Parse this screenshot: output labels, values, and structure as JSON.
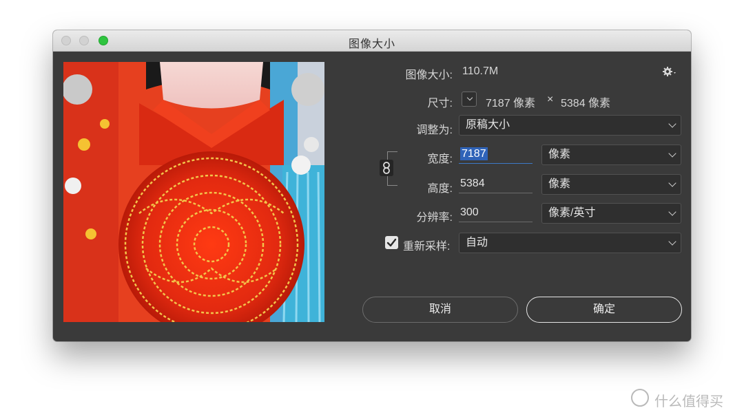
{
  "window": {
    "title": "图像大小"
  },
  "image_size": {
    "label": "图像大小:",
    "value": "110.7M"
  },
  "dimensions": {
    "label": "尺寸:",
    "width": "7187 像素",
    "separator": "×",
    "height": "5384 像素"
  },
  "fit_to": {
    "label": "调整为:",
    "value": "原稿大小"
  },
  "width": {
    "label": "宽度:",
    "value": "7187",
    "unit": "像素"
  },
  "height": {
    "label": "高度:",
    "value": "5384",
    "unit": "像素"
  },
  "resolution": {
    "label": "分辨率:",
    "value": "300",
    "unit": "像素/英寸"
  },
  "resample": {
    "label": "重新采样:",
    "checked": true,
    "value": "自动"
  },
  "buttons": {
    "cancel": "取消",
    "ok": "确定"
  },
  "watermark": {
    "text": "什么值得买"
  },
  "colors": {
    "accent": "#2f63b8",
    "traffic_max": "#2fc43f",
    "dialog_bg": "#3a3a3a"
  }
}
